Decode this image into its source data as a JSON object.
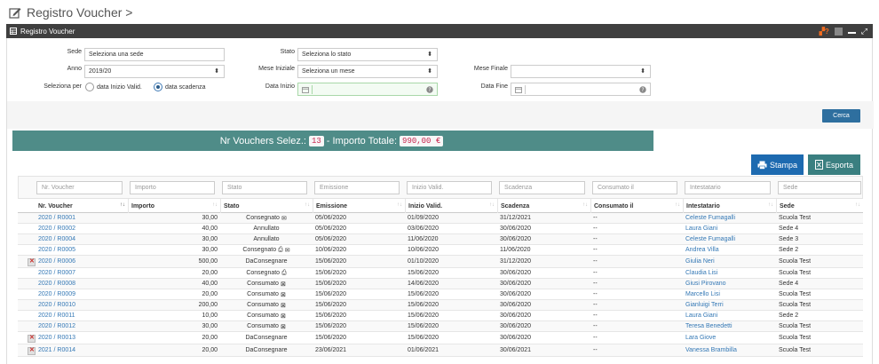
{
  "page": {
    "title": "Registro Voucher >"
  },
  "panel": {
    "title": "Registro Voucher"
  },
  "filters": {
    "sede_label": "Sede",
    "sede_value": "Seleziona una sede",
    "anno_label": "Anno",
    "anno_value": "2019/20",
    "seleziona_per_label": "Seleziona per",
    "radio_inizio": "data Inizio Valid.",
    "radio_scadenza": "data scadenza",
    "stato_label": "Stato",
    "stato_value": "Seleziona lo stato",
    "mese_iniziale_label": "Mese Iniziale",
    "mese_iniziale_value": "Seleziona un mese",
    "data_inizio_label": "Data Inizio",
    "mese_finale_label": "Mese Finale",
    "data_fine_label": "Data Fine",
    "cerca": "Cerca"
  },
  "summary": {
    "label1": "Nr Vouchers Selez.:",
    "count": "13",
    "label2": "- Importo Totale:",
    "total": "990,00 €"
  },
  "actions": {
    "stampa": "Stampa",
    "esporta": "Esporta"
  },
  "table": {
    "filter_placeholders": [
      "Nr. Voucher",
      "Importo",
      "Stato",
      "Emissione",
      "Inizio Valid.",
      "Scadenza",
      "Consumato il",
      "Intestatario",
      "Sede"
    ],
    "headers": [
      "Nr. Voucher",
      "Importo",
      "Stato",
      "Emissione",
      "Inizio Valid.",
      "Scadenza",
      "Consumato il",
      "Intestatario",
      "Sede"
    ],
    "rows": [
      {
        "nr": "2020 / R0001",
        "importo": "30,00",
        "stato": "Consegnato",
        "icons": [
          "envelope"
        ],
        "emissione": "05/06/2020",
        "inizio": "01/09/2020",
        "scadenza": "31/12/2021",
        "consumato": "--",
        "intestatario": "Celeste Fumagalli",
        "sede": "Scuola Test",
        "del": false
      },
      {
        "nr": "2020 / R0002",
        "importo": "40,00",
        "stato": "Annullato",
        "icons": [],
        "emissione": "05/06/2020",
        "inizio": "03/06/2020",
        "scadenza": "30/06/2020",
        "consumato": "--",
        "intestatario": "Laura Giani",
        "sede": "Sede 4",
        "del": false
      },
      {
        "nr": "2020 / R0004",
        "importo": "30,00",
        "stato": "Annullato",
        "icons": [],
        "emissione": "05/06/2020",
        "inizio": "11/06/2020",
        "scadenza": "30/06/2020",
        "consumato": "--",
        "intestatario": "Celeste Fumagalli",
        "sede": "Sede 3",
        "del": false
      },
      {
        "nr": "2020 / R0005",
        "importo": "30,00",
        "stato": "Consegnato",
        "icons": [
          "print",
          "envelope"
        ],
        "emissione": "10/06/2020",
        "inizio": "10/06/2020",
        "scadenza": "11/06/2020",
        "consumato": "--",
        "intestatario": "Andrea Villa",
        "sede": "Sede 2",
        "del": false
      },
      {
        "nr": "2020 / R0006",
        "importo": "500,00",
        "stato": "DaConsegnare",
        "icons": [],
        "emissione": "15/06/2020",
        "inizio": "01/10/2020",
        "scadenza": "31/12/2020",
        "consumato": "--",
        "intestatario": "Giulia Neri",
        "sede": "Scuola Test",
        "del": true
      },
      {
        "nr": "2020 / R0007",
        "importo": "20,00",
        "stato": "Consegnato",
        "icons": [
          "print"
        ],
        "emissione": "15/06/2020",
        "inizio": "15/06/2020",
        "scadenza": "30/06/2020",
        "consumato": "--",
        "intestatario": "Claudia Lisi",
        "sede": "Scuola Test",
        "del": false
      },
      {
        "nr": "2020 / R0008",
        "importo": "40,00",
        "stato": "Consumato",
        "icons": [
          "card"
        ],
        "emissione": "15/06/2020",
        "inizio": "14/06/2020",
        "scadenza": "30/06/2020",
        "consumato": "--",
        "intestatario": "Giusi Pirovano",
        "sede": "Sede 4",
        "del": false
      },
      {
        "nr": "2020 / R0009",
        "importo": "20,00",
        "stato": "Consumato",
        "icons": [
          "card"
        ],
        "emissione": "15/06/2020",
        "inizio": "15/06/2020",
        "scadenza": "30/06/2020",
        "consumato": "--",
        "intestatario": "Marcello Lisi",
        "sede": "Scuola Test",
        "del": false
      },
      {
        "nr": "2020 / R0010",
        "importo": "200,00",
        "stato": "Consumato",
        "icons": [
          "card"
        ],
        "emissione": "15/06/2020",
        "inizio": "15/06/2020",
        "scadenza": "30/06/2020",
        "consumato": "--",
        "intestatario": "Gianluigi Terri",
        "sede": "Scuola Test",
        "del": false
      },
      {
        "nr": "2020 / R0011",
        "importo": "10,00",
        "stato": "Consumato",
        "icons": [
          "card"
        ],
        "emissione": "15/06/2020",
        "inizio": "15/06/2020",
        "scadenza": "30/06/2020",
        "consumato": "--",
        "intestatario": "Laura Giani",
        "sede": "Sede 2",
        "del": false
      },
      {
        "nr": "2020 / R0012",
        "importo": "30,00",
        "stato": "Consumato",
        "icons": [
          "card"
        ],
        "emissione": "15/06/2020",
        "inizio": "15/06/2020",
        "scadenza": "30/06/2020",
        "consumato": "--",
        "intestatario": "Teresa Benedetti",
        "sede": "Scuola Test",
        "del": false
      },
      {
        "nr": "2020 / R0013",
        "importo": "20,00",
        "stato": "DaConsegnare",
        "icons": [],
        "emissione": "15/06/2020",
        "inizio": "15/06/2020",
        "scadenza": "30/06/2020",
        "consumato": "--",
        "intestatario": "Lara Giove",
        "sede": "Scuola Test",
        "del": true
      },
      {
        "nr": "2021 / R0014",
        "importo": "20,00",
        "stato": "DaConsegnare",
        "icons": [],
        "emissione": "23/06/2021",
        "inizio": "01/06/2021",
        "scadenza": "30/06/2021",
        "consumato": "--",
        "intestatario": "Vanessa Brambilla",
        "sede": "Scuola Test",
        "del": true
      }
    ]
  },
  "colors": {
    "link": "#3478b5",
    "summary_bg": "#4f8c88",
    "stampa_bg": "#1d6ab0",
    "esporta_bg": "#3a7f80",
    "cerca_bg": "#2e6f9f"
  }
}
